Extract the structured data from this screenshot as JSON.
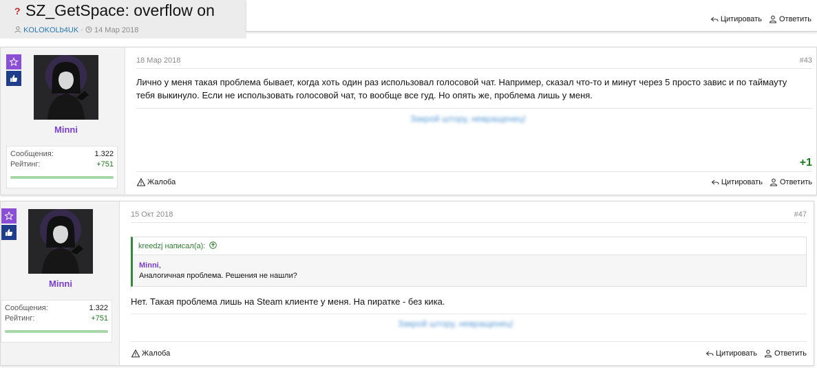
{
  "thread": {
    "title": "SZ_GetSpace: overflow on",
    "author": "KOLOKOLb4UK",
    "date": "14 Мар 2018"
  },
  "actions": {
    "quote": "Цитировать",
    "reply": "Ответить",
    "report": "Жалоба"
  },
  "posts": [
    {
      "user": {
        "name": "Minni",
        "messages_label": "Сообщения:",
        "messages": "1.322",
        "rating_label": "Рейтинг:",
        "rating": "+751",
        "rating_fill": 1.0
      },
      "date": "18 Мар 2018",
      "number": "#43",
      "body": "Лично у меня такая проблема бывает, когда хоть один раз использовал голосовой чат. Например, сказал что-то и минут через 5 просто завис и по таймауту тебя выкинуло. Если не использовать голосовой чат, то вообще все гуд. Но опять же, проблема лишь у меня.",
      "signature": "Закрой штору, невращенец!",
      "score": "+1"
    },
    {
      "user": {
        "name": "Minni",
        "messages_label": "Сообщения:",
        "messages": "1.322",
        "rating_label": "Рейтинг:",
        "rating": "+751",
        "rating_fill": 1.0
      },
      "date": "15 Окт 2018",
      "number": "#47",
      "quote": {
        "header": "kreedzj написал(а):",
        "name": "Minni",
        "text": "Аналогичная проблема. Решения не нашли?"
      },
      "body": "Нет. Такая проблема лишь на Steam клиенте у меня. На пиратке - без кика.",
      "signature": "Закрой штору, невращенец!"
    }
  ],
  "colors": {
    "accent_purple": "#7a3fd0",
    "badge_star": "#8a4fd6",
    "badge_like": "#1f3d8a",
    "positive_green": "#1b7a1b",
    "link_blue": "#2577b1"
  },
  "icons": [
    "question-icon",
    "user-icon",
    "clock-icon",
    "quote-icon",
    "reply-icon",
    "star-icon",
    "thumbs-up-icon",
    "warning-icon",
    "arrow-up-icon"
  ]
}
